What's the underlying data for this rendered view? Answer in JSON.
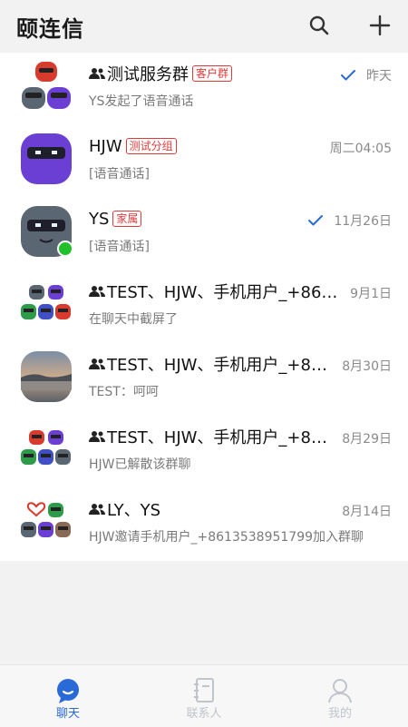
{
  "header": {
    "title": "颐连信",
    "search_icon": "search-icon",
    "add_icon": "plus-icon"
  },
  "conversations": [
    {
      "name": "测试服务群",
      "group": true,
      "tag": "客户群",
      "time": "昨天",
      "read": true,
      "preview": "YS发起了语音通话",
      "avatar": "group-robots"
    },
    {
      "name": "HJW",
      "group": false,
      "tag": "测试分组",
      "time": "周二04:05",
      "read": false,
      "preview": "[语音通话]",
      "avatar": "purple-robot"
    },
    {
      "name": "YS",
      "group": false,
      "tag": "家属",
      "time": "11月26日",
      "read": true,
      "preview": "[语音通话]",
      "avatar": "gray-robot",
      "online": true
    },
    {
      "name": "TEST、HJW、手机用户_+86…",
      "group": true,
      "tag": "",
      "time": "9月1日",
      "read": false,
      "preview": "在聊天中截屏了",
      "avatar": "group-robots"
    },
    {
      "name": "TEST、HJW、手机用户_+8…",
      "group": true,
      "tag": "",
      "time": "8月30日",
      "read": false,
      "preview": "TEST：呵呵",
      "avatar": "lake-photo"
    },
    {
      "name": "TEST、HJW、手机用户_+8…",
      "group": true,
      "tag": "",
      "time": "8月29日",
      "read": false,
      "preview": "HJW已解散该群聊",
      "avatar": "group-robots"
    },
    {
      "name": "LY、YS",
      "group": true,
      "tag": "",
      "time": "8月14日",
      "read": false,
      "preview": "HJW邀请手机用户_+8613538951799加入群聊",
      "avatar": "group-robots"
    }
  ],
  "tabs": [
    {
      "label": "聊天",
      "icon": "chat-bubble-icon",
      "active": true
    },
    {
      "label": "联系人",
      "icon": "contacts-book-icon",
      "active": false
    },
    {
      "label": "我的",
      "icon": "person-icon",
      "active": false
    }
  ],
  "colors": {
    "accent": "#2a6ad8",
    "tag_red": "#e03b3b",
    "online_green": "#22c02a"
  }
}
